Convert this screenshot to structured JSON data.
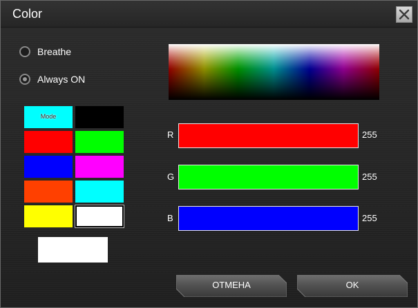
{
  "window": {
    "title": "Color"
  },
  "mode": {
    "options": [
      {
        "label": "Breathe",
        "checked": false
      },
      {
        "label": "Always ON",
        "checked": true
      }
    ]
  },
  "palette": {
    "mode_label": "Mode",
    "swatches": [
      {
        "color": "#00ffff"
      },
      {
        "color": "#000000"
      },
      {
        "color": "#ff0000"
      },
      {
        "color": "#00ff00"
      },
      {
        "color": "#0000ff"
      },
      {
        "color": "#ff00ff"
      },
      {
        "color": "#ff4000"
      },
      {
        "color": "#00ffff"
      },
      {
        "color": "#ffff00"
      },
      {
        "color": "#ffffff",
        "selected": true
      }
    ],
    "preview_color": "#ffffff"
  },
  "channels": [
    {
      "letter": "R",
      "value": "255",
      "color": "#ff0000"
    },
    {
      "letter": "G",
      "value": "255",
      "color": "#00ff00"
    },
    {
      "letter": "B",
      "value": "255",
      "color": "#0000ff"
    }
  ],
  "buttons": {
    "cancel_label": "ОТМЕНА",
    "ok_label": "OK"
  }
}
